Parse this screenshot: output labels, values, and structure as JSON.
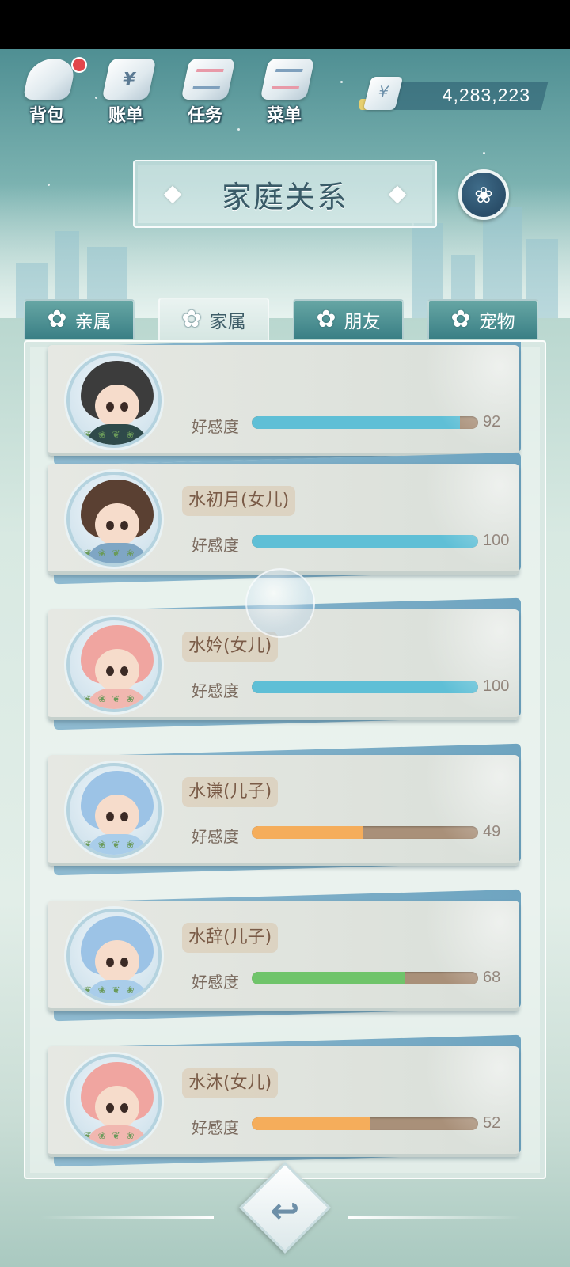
{
  "top_menu": [
    {
      "label": "背包",
      "icon": "backpack-icon",
      "badge": true
    },
    {
      "label": "账单",
      "icon": "bill-icon",
      "badge": false
    },
    {
      "label": "任务",
      "icon": "task-icon",
      "badge": false
    },
    {
      "label": "菜单",
      "icon": "menu-icon",
      "badge": false
    }
  ],
  "money": {
    "icon": "yen-icon",
    "currency_symbol": "¥",
    "value": "4,283,223"
  },
  "title": {
    "text": "家庭关系"
  },
  "tabs": [
    {
      "label": "亲属",
      "icon": "flower-icon",
      "active": false
    },
    {
      "label": "家属",
      "icon": "flower-icon",
      "active": true
    },
    {
      "label": "朋友",
      "icon": "flower-icon",
      "active": false
    },
    {
      "label": "宠物",
      "icon": "flower-icon",
      "active": false
    }
  ],
  "affection_label": "好感度",
  "members": [
    {
      "name": "",
      "affection": 92,
      "bar_color": "#5fbfd6",
      "avatar": "boy-dark-outfit"
    },
    {
      "name": "水初月(女儿)",
      "affection": 100,
      "bar_color": "#5fbfd6",
      "avatar": "girl-brown-hair"
    },
    {
      "name": "水妗(女儿)",
      "affection": 100,
      "bar_color": "#5fbfd6",
      "avatar": "pink-hood"
    },
    {
      "name": "水谦(儿子)",
      "affection": 49,
      "bar_color": "#f5ad5b",
      "avatar": "blue-hood"
    },
    {
      "name": "水辞(儿子)",
      "affection": 68,
      "bar_color": "#6fc46a",
      "avatar": "blue-hood"
    },
    {
      "name": "水沐(女儿)",
      "affection": 52,
      "bar_color": "#f5ad5b",
      "avatar": "pink-hood"
    }
  ],
  "colors": {
    "bar_track": "#a99079",
    "tab_inactive": "#3a7f85",
    "title_text": "#3a5b68"
  },
  "back_button": {
    "icon": "back-arrow-icon",
    "glyph": "↩"
  }
}
